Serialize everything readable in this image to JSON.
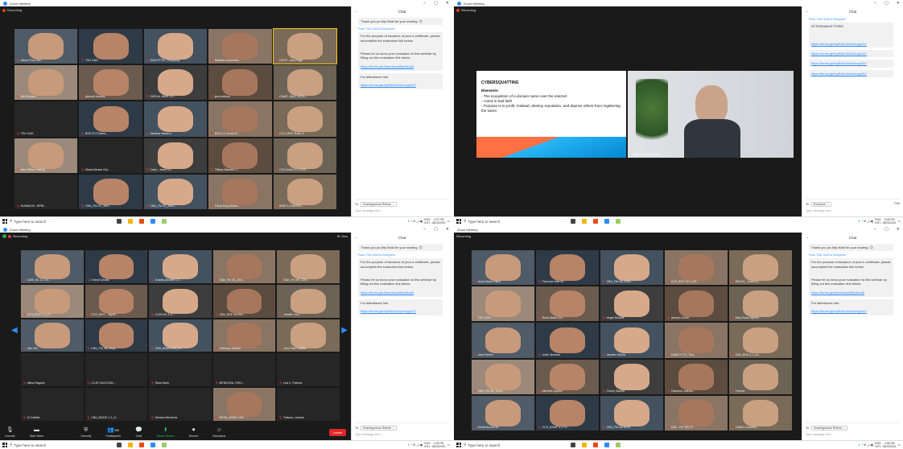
{
  "app_title": "Zoom Meeting",
  "recording_label": "Recording",
  "view_label": "View",
  "chat": {
    "title": "Chat",
    "msg_thanks": "Thank you po Atty Maki for your sharing.",
    "from_label": "From TSU GAD to Everyone:",
    "msg_certificate": "For the purpose of issuance of your e-certificate, please accomplish the evaluation link below.",
    "msg_evaluation": "Please let us know your evaluation to this webinar by filling out this evaluation link below:",
    "link_eval": "https://forms.gle/8mmxkcp55tpXbq46",
    "msg_attendance": "For attendance link:",
    "link_attendance": "https://forms.gle/syRAcXhAoHLzgdZc7",
    "attendance_form": "ATTENDANCE FORM",
    "to_label": "To:",
    "to_value_1": "Charleyjoshua Rellore",
    "to_value_2": "Everyone",
    "placeholder": "Type message here...",
    "file_label": "File"
  },
  "taskbar": {
    "search_placeholder": "Type here to search",
    "lang": "ENG",
    "lang2": "INTL",
    "time_1": "4:37 PM",
    "time_2": "5:08 PM",
    "time_3": "4:39 PM",
    "time_4": "4:36 PM",
    "date": "08/23/2021"
  },
  "slide": {
    "title": "CYBERSQUATTING",
    "elements_label": "Elements:",
    "item_1": "The acquisition of a domain name over the internet",
    "item_2": "Acted in bad faith",
    "item_3": "Purpose is to profit, mislead, destroy reputation, and deprive others from registering the same.",
    "speaker_name": "Marco Polo Gutierrez"
  },
  "toolbar": {
    "unmute": "Unmute",
    "start_video": "Start Video",
    "security": "Security",
    "participants": "Participants",
    "participants_count": "366",
    "chat": "Chat",
    "share_screen": "Share Screen",
    "record": "Record",
    "reactions": "Reactions",
    "leave": "Leave"
  },
  "q1_participants": [
    "Marco Polo Gut...",
    "TSU GAD",
    "GAD-PTTN - Pampang",
    "Mikaela Lacamana",
    "HCOT - Ana Faga",
    "Wet Gulnes",
    "gherold bendez",
    "SHEILA JANE GO...",
    "jenn setioso",
    "CAMS- BAIC JESSI...",
    "TSU GAD",
    "BSS 2C3 Diane...",
    "Janaina Navarro",
    "BSA 3-2 Jonah M...",
    "CCS_BSIT-Raffy S...",
    "Alex Tiffany Yabing",
    "Maria Denise Gal...",
    "Carlo - Janel Co...",
    "Tiffany Blanche C...",
    "CCS-Arvin 3-2 JOSE...",
    "HUMALDE, JERB...",
    "CBA_FM 3C_Jeth...",
    "CBA_FM 3C_Jeric...",
    "Fiona Ruby Alcan...",
    "BSIE 1-A NEOKL..."
  ],
  "q3_participants": [
    "CARL 8C 3-1 Jo...",
    "Cheryl Cecilia",
    "Charity Alcober Cu...",
    "CBA_FM 3B_Jero...",
    "CBA_FM 4B_JOH...",
    "CCS_BSIT 1-3_R...",
    "CCS_BSIT - Jayde...",
    "CCIS BS 3-A-...",
    "CBA_BSE Ina Nei...",
    "Jobelle Cruz",
    "Jam Ver",
    "CBA_FM 4B_Regi...",
    "CBA_BSAIS 1-3_Ji...",
    "Jefferson Alberto",
    "John Paul Padilla",
    "Allina Naguim",
    "CCJE GACUTAN ...",
    "Shae Bello",
    "MENDOZA, ERIC...",
    "Lea C. Patricio",
    "Al Castillo",
    "CBA_BSAIS 1-1_H...",
    "Monica Mendoza",
    "MEHA_BSBA-JAN...",
    "Tolacao, Joshua"
  ],
  "q4_participants": [
    "Anne Marie Fabul",
    "Florence Mae Br...",
    "CBA_FM 4B_EMIL...",
    "CCS_BSIT 2D_LAR...",
    "BSA 3C_Joana la...",
    "TSU GAD",
    "Rose Marie Cor...",
    "Angel Medina",
    "Janelyn Dizon",
    "Mary Rose Aquino",
    "Jose Reben",
    "Juliet Jimenez",
    "Janette Garcia",
    "CABA VTYC_Rey...",
    "CBA_BSA 3-1_Ka...",
    "CBA_FM 3B_Tome...",
    "Michelle Aquino",
    "Coney Santos",
    "Clarence Joshua...",
    "Yvonne",
    "Kimberly Ann M...",
    "CCS_BSMP 4-1 Fe...",
    "CBA_FM 3A-MOR...",
    "CBA - FM 4B] FE...",
    "CAMS Conwelle..."
  ]
}
